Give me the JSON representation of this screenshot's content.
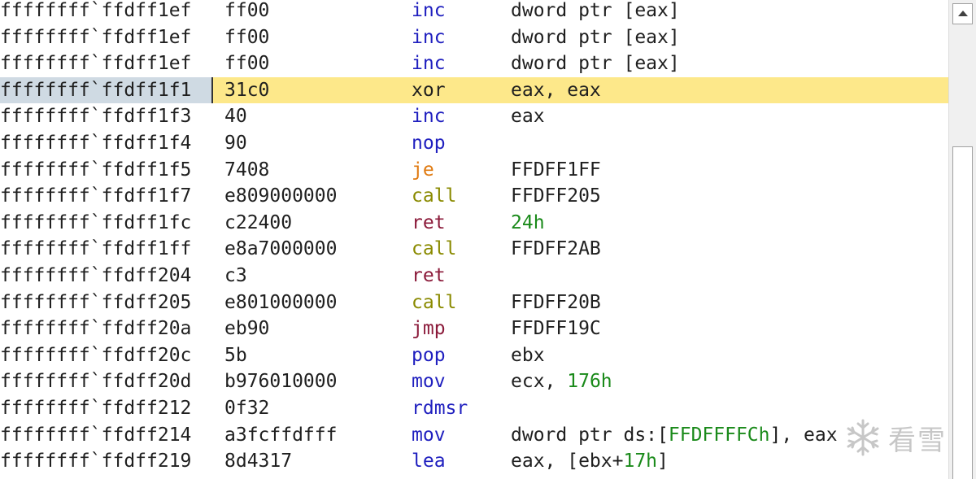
{
  "rows": [
    {
      "addr": "ffffffff`ffdff1ef",
      "bytes": "ff00",
      "mnemonic": "inc",
      "operands": [
        {
          "t": "dword ptr [eax]"
        }
      ]
    },
    {
      "addr": "ffffffff`ffdff1ef",
      "bytes": "ff00",
      "mnemonic": "inc",
      "operands": [
        {
          "t": "dword ptr [eax]"
        }
      ]
    },
    {
      "addr": "ffffffff`ffdff1ef",
      "bytes": "ff00",
      "mnemonic": "inc",
      "operands": [
        {
          "t": "dword ptr [eax]"
        }
      ]
    },
    {
      "addr": "ffffffff`ffdff1f1",
      "bytes": "31c0",
      "mnemonic": "xor",
      "operands": [
        {
          "t": "eax, eax"
        }
      ],
      "current": true
    },
    {
      "addr": "ffffffff`ffdff1f3",
      "bytes": "40",
      "mnemonic": "inc",
      "operands": [
        {
          "t": "eax"
        }
      ]
    },
    {
      "addr": "ffffffff`ffdff1f4",
      "bytes": "90",
      "mnemonic": "nop",
      "operands": []
    },
    {
      "addr": "ffffffff`ffdff1f5",
      "bytes": "7408",
      "mnemonic": "je",
      "operands": [
        {
          "t": "FFDFF1FF"
        }
      ]
    },
    {
      "addr": "ffffffff`ffdff1f7",
      "bytes": "e809000000",
      "mnemonic": "call",
      "operands": [
        {
          "t": "FFDFF205"
        }
      ]
    },
    {
      "addr": "ffffffff`ffdff1fc",
      "bytes": "c22400",
      "mnemonic": "ret",
      "operands": [
        {
          "t": "24h",
          "num": true
        }
      ]
    },
    {
      "addr": "ffffffff`ffdff1ff",
      "bytes": "e8a7000000",
      "mnemonic": "call",
      "operands": [
        {
          "t": "FFDFF2AB"
        }
      ]
    },
    {
      "addr": "ffffffff`ffdff204",
      "bytes": "c3",
      "mnemonic": "ret",
      "operands": []
    },
    {
      "addr": "ffffffff`ffdff205",
      "bytes": "e801000000",
      "mnemonic": "call",
      "operands": [
        {
          "t": "FFDFF20B"
        }
      ]
    },
    {
      "addr": "ffffffff`ffdff20a",
      "bytes": "eb90",
      "mnemonic": "jmp",
      "operands": [
        {
          "t": "FFDFF19C"
        }
      ]
    },
    {
      "addr": "ffffffff`ffdff20c",
      "bytes": "5b",
      "mnemonic": "pop",
      "operands": [
        {
          "t": "ebx"
        }
      ]
    },
    {
      "addr": "ffffffff`ffdff20d",
      "bytes": "b976010000",
      "mnemonic": "mov",
      "operands": [
        {
          "t": "ecx, "
        },
        {
          "t": "176h",
          "num": true
        }
      ]
    },
    {
      "addr": "ffffffff`ffdff212",
      "bytes": "0f32",
      "mnemonic": "rdmsr",
      "operands": []
    },
    {
      "addr": "ffffffff`ffdff214",
      "bytes": "a3fcffdfff",
      "mnemonic": "mov",
      "operands": [
        {
          "t": "dword ptr ds:["
        },
        {
          "t": "FFDFFFFCh",
          "num": true
        },
        {
          "t": "], eax"
        }
      ]
    },
    {
      "addr": "ffffffff`ffdff219",
      "bytes": "8d4317",
      "mnemonic": "lea",
      "operands": [
        {
          "t": "eax, [ebx+"
        },
        {
          "t": "17h",
          "num": true
        },
        {
          "t": "]"
        }
      ]
    }
  ],
  "watermark": {
    "text": "看雪"
  },
  "icons": {
    "scroll_up": "triangle-up-icon",
    "watermark": "snowflake-icon"
  }
}
